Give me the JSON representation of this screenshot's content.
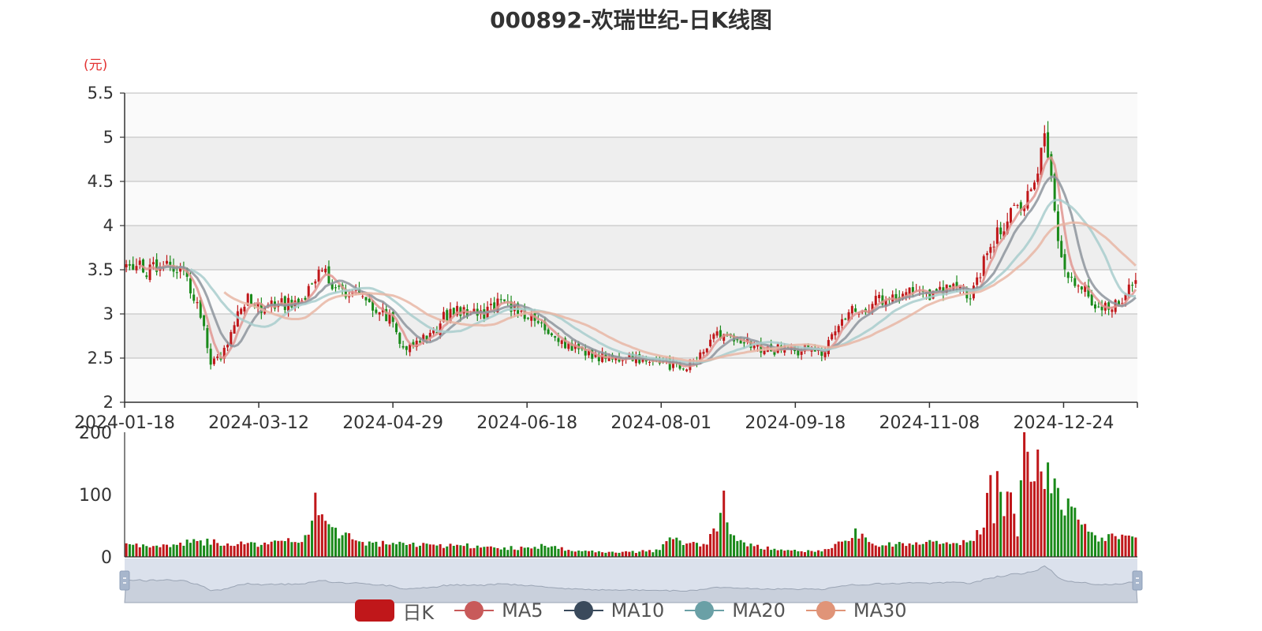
{
  "title": "000892-欢瑞世纪-日K线图",
  "unit_label": "(元)",
  "colors": {
    "up": "#c0171a",
    "down": "#1a8a1a",
    "ma5": "#e09591",
    "ma10": "#8d949c",
    "ma20": "#a8cccc",
    "ma30": "#e8b6a4",
    "grid_band": "#eeeeee",
    "grid_line": "#c8c8c8",
    "slider_bg": "#dbe1ec",
    "slider_handle": "#a7b6cc",
    "legend_k": "#c0171a",
    "legend_ma5": "#c85a5a",
    "legend_ma10": "#3a4a5c",
    "legend_ma20": "#6aa0a6",
    "legend_ma30": "#e09478"
  },
  "legend": [
    {
      "key": "k",
      "label": "日K"
    },
    {
      "key": "ma5",
      "label": "MA5"
    },
    {
      "key": "ma10",
      "label": "MA10"
    },
    {
      "key": "ma20",
      "label": "MA20"
    },
    {
      "key": "ma30",
      "label": "MA30"
    }
  ],
  "chart_data": {
    "type": "candlestick",
    "x_tick_labels": [
      "2024-01-18",
      "2024-03-12",
      "2024-04-29",
      "2024-06-18",
      "2024-08-01",
      "2024-09-18",
      "2024-11-08",
      "2024-12-24"
    ],
    "price_axis": {
      "ylim": [
        2,
        5.5
      ],
      "ticks": [
        "2",
        "2.5",
        "3",
        "3.5",
        "4",
        "4.5",
        "5",
        "5.5"
      ]
    },
    "volume_axis": {
      "ylim": [
        0,
        200
      ],
      "ticks": [
        "0",
        "100",
        "200"
      ]
    },
    "close_anchors": [
      [
        0,
        3.65
      ],
      [
        6,
        3.45
      ],
      [
        12,
        3.62
      ],
      [
        18,
        3.4
      ],
      [
        22,
        3.0
      ],
      [
        25,
        2.45
      ],
      [
        28,
        2.5
      ],
      [
        32,
        2.9
      ],
      [
        36,
        3.2
      ],
      [
        40,
        3.05
      ],
      [
        45,
        3.1
      ],
      [
        52,
        3.15
      ],
      [
        58,
        3.5
      ],
      [
        62,
        3.3
      ],
      [
        66,
        3.25
      ],
      [
        70,
        3.2
      ],
      [
        74,
        3.05
      ],
      [
        78,
        2.95
      ],
      [
        82,
        2.6
      ],
      [
        86,
        2.7
      ],
      [
        90,
        2.75
      ],
      [
        94,
        2.95
      ],
      [
        100,
        3.05
      ],
      [
        105,
        3.0
      ],
      [
        110,
        3.1
      ],
      [
        116,
        3.05
      ],
      [
        122,
        2.9
      ],
      [
        127,
        2.7
      ],
      [
        132,
        2.6
      ],
      [
        137,
        2.55
      ],
      [
        142,
        2.5
      ],
      [
        147,
        2.5
      ],
      [
        152,
        2.48
      ],
      [
        157,
        2.45
      ],
      [
        162,
        2.42
      ],
      [
        166,
        2.4
      ],
      [
        170,
        2.55
      ],
      [
        174,
        2.75
      ],
      [
        178,
        2.7
      ],
      [
        182,
        2.68
      ],
      [
        186,
        2.65
      ],
      [
        190,
        2.6
      ],
      [
        194,
        2.6
      ],
      [
        198,
        2.58
      ],
      [
        202,
        2.6
      ],
      [
        206,
        2.55
      ],
      [
        210,
        2.85
      ],
      [
        214,
        3.05
      ],
      [
        220,
        3.1
      ],
      [
        226,
        3.2
      ],
      [
        232,
        3.25
      ],
      [
        238,
        3.2
      ],
      [
        244,
        3.3
      ],
      [
        250,
        3.2
      ],
      [
        254,
        3.6
      ],
      [
        258,
        3.9
      ],
      [
        262,
        4.1
      ],
      [
        266,
        4.3
      ],
      [
        270,
        4.6
      ],
      [
        272,
        4.95
      ],
      [
        274,
        4.5
      ],
      [
        276,
        3.9
      ],
      [
        279,
        3.4
      ],
      [
        283,
        3.3
      ],
      [
        287,
        3.1
      ],
      [
        291,
        3.05
      ],
      [
        294,
        3.1
      ],
      [
        297,
        3.3
      ],
      [
        299,
        3.3
      ]
    ],
    "volume_anchors": [
      [
        0,
        18
      ],
      [
        10,
        16
      ],
      [
        20,
        25
      ],
      [
        28,
        22
      ],
      [
        33,
        22
      ],
      [
        40,
        20
      ],
      [
        48,
        25
      ],
      [
        54,
        30
      ],
      [
        56,
        112
      ],
      [
        58,
        60
      ],
      [
        60,
        45
      ],
      [
        70,
        22
      ],
      [
        80,
        20
      ],
      [
        90,
        18
      ],
      [
        100,
        18
      ],
      [
        110,
        14
      ],
      [
        118,
        14
      ],
      [
        125,
        18
      ],
      [
        132,
        10
      ],
      [
        140,
        8
      ],
      [
        150,
        8
      ],
      [
        158,
        10
      ],
      [
        162,
        35
      ],
      [
        166,
        18
      ],
      [
        172,
        22
      ],
      [
        175,
        45
      ],
      [
        177,
        88
      ],
      [
        179,
        45
      ],
      [
        182,
        22
      ],
      [
        190,
        14
      ],
      [
        198,
        12
      ],
      [
        204,
        8
      ],
      [
        210,
        18
      ],
      [
        214,
        25
      ],
      [
        216,
        42
      ],
      [
        218,
        30
      ],
      [
        222,
        18
      ],
      [
        230,
        20
      ],
      [
        240,
        22
      ],
      [
        248,
        24
      ],
      [
        250,
        30
      ],
      [
        254,
        42
      ],
      [
        256,
        148
      ],
      [
        257,
        60
      ],
      [
        258,
        180
      ],
      [
        260,
        60
      ],
      [
        262,
        120
      ],
      [
        264,
        40
      ],
      [
        266,
        200
      ],
      [
        268,
        100
      ],
      [
        270,
        150
      ],
      [
        272,
        140
      ],
      [
        274,
        130
      ],
      [
        276,
        110
      ],
      [
        278,
        80
      ],
      [
        282,
        60
      ],
      [
        286,
        32
      ],
      [
        290,
        30
      ],
      [
        294,
        30
      ],
      [
        297,
        45
      ],
      [
        299,
        25
      ]
    ],
    "count": 300,
    "series": [
      {
        "name": "日K"
      },
      {
        "name": "MA5"
      },
      {
        "name": "MA10"
      },
      {
        "name": "MA20"
      },
      {
        "name": "MA30"
      }
    ]
  }
}
